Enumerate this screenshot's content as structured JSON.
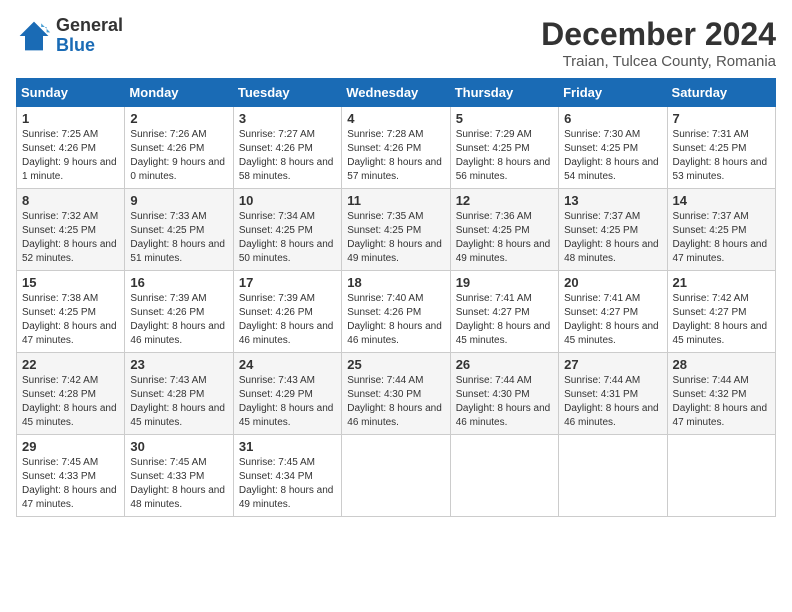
{
  "header": {
    "logo_general": "General",
    "logo_blue": "Blue",
    "main_title": "December 2024",
    "subtitle": "Traian, Tulcea County, Romania"
  },
  "calendar": {
    "days_of_week": [
      "Sunday",
      "Monday",
      "Tuesday",
      "Wednesday",
      "Thursday",
      "Friday",
      "Saturday"
    ],
    "weeks": [
      [
        {
          "day": "1",
          "sunrise": "7:25 AM",
          "sunset": "4:26 PM",
          "daylight": "9 hours and 1 minute."
        },
        {
          "day": "2",
          "sunrise": "7:26 AM",
          "sunset": "4:26 PM",
          "daylight": "9 hours and 0 minutes."
        },
        {
          "day": "3",
          "sunrise": "7:27 AM",
          "sunset": "4:26 PM",
          "daylight": "8 hours and 58 minutes."
        },
        {
          "day": "4",
          "sunrise": "7:28 AM",
          "sunset": "4:26 PM",
          "daylight": "8 hours and 57 minutes."
        },
        {
          "day": "5",
          "sunrise": "7:29 AM",
          "sunset": "4:25 PM",
          "daylight": "8 hours and 56 minutes."
        },
        {
          "day": "6",
          "sunrise": "7:30 AM",
          "sunset": "4:25 PM",
          "daylight": "8 hours and 54 minutes."
        },
        {
          "day": "7",
          "sunrise": "7:31 AM",
          "sunset": "4:25 PM",
          "daylight": "8 hours and 53 minutes."
        }
      ],
      [
        {
          "day": "8",
          "sunrise": "7:32 AM",
          "sunset": "4:25 PM",
          "daylight": "8 hours and 52 minutes."
        },
        {
          "day": "9",
          "sunrise": "7:33 AM",
          "sunset": "4:25 PM",
          "daylight": "8 hours and 51 minutes."
        },
        {
          "day": "10",
          "sunrise": "7:34 AM",
          "sunset": "4:25 PM",
          "daylight": "8 hours and 50 minutes."
        },
        {
          "day": "11",
          "sunrise": "7:35 AM",
          "sunset": "4:25 PM",
          "daylight": "8 hours and 49 minutes."
        },
        {
          "day": "12",
          "sunrise": "7:36 AM",
          "sunset": "4:25 PM",
          "daylight": "8 hours and 49 minutes."
        },
        {
          "day": "13",
          "sunrise": "7:37 AM",
          "sunset": "4:25 PM",
          "daylight": "8 hours and 48 minutes."
        },
        {
          "day": "14",
          "sunrise": "7:37 AM",
          "sunset": "4:25 PM",
          "daylight": "8 hours and 47 minutes."
        }
      ],
      [
        {
          "day": "15",
          "sunrise": "7:38 AM",
          "sunset": "4:25 PM",
          "daylight": "8 hours and 47 minutes."
        },
        {
          "day": "16",
          "sunrise": "7:39 AM",
          "sunset": "4:26 PM",
          "daylight": "8 hours and 46 minutes."
        },
        {
          "day": "17",
          "sunrise": "7:39 AM",
          "sunset": "4:26 PM",
          "daylight": "8 hours and 46 minutes."
        },
        {
          "day": "18",
          "sunrise": "7:40 AM",
          "sunset": "4:26 PM",
          "daylight": "8 hours and 46 minutes."
        },
        {
          "day": "19",
          "sunrise": "7:41 AM",
          "sunset": "4:27 PM",
          "daylight": "8 hours and 45 minutes."
        },
        {
          "day": "20",
          "sunrise": "7:41 AM",
          "sunset": "4:27 PM",
          "daylight": "8 hours and 45 minutes."
        },
        {
          "day": "21",
          "sunrise": "7:42 AM",
          "sunset": "4:27 PM",
          "daylight": "8 hours and 45 minutes."
        }
      ],
      [
        {
          "day": "22",
          "sunrise": "7:42 AM",
          "sunset": "4:28 PM",
          "daylight": "8 hours and 45 minutes."
        },
        {
          "day": "23",
          "sunrise": "7:43 AM",
          "sunset": "4:28 PM",
          "daylight": "8 hours and 45 minutes."
        },
        {
          "day": "24",
          "sunrise": "7:43 AM",
          "sunset": "4:29 PM",
          "daylight": "8 hours and 45 minutes."
        },
        {
          "day": "25",
          "sunrise": "7:44 AM",
          "sunset": "4:30 PM",
          "daylight": "8 hours and 46 minutes."
        },
        {
          "day": "26",
          "sunrise": "7:44 AM",
          "sunset": "4:30 PM",
          "daylight": "8 hours and 46 minutes."
        },
        {
          "day": "27",
          "sunrise": "7:44 AM",
          "sunset": "4:31 PM",
          "daylight": "8 hours and 46 minutes."
        },
        {
          "day": "28",
          "sunrise": "7:44 AM",
          "sunset": "4:32 PM",
          "daylight": "8 hours and 47 minutes."
        }
      ],
      [
        {
          "day": "29",
          "sunrise": "7:45 AM",
          "sunset": "4:33 PM",
          "daylight": "8 hours and 47 minutes."
        },
        {
          "day": "30",
          "sunrise": "7:45 AM",
          "sunset": "4:33 PM",
          "daylight": "8 hours and 48 minutes."
        },
        {
          "day": "31",
          "sunrise": "7:45 AM",
          "sunset": "4:34 PM",
          "daylight": "8 hours and 49 minutes."
        },
        null,
        null,
        null,
        null
      ]
    ]
  }
}
